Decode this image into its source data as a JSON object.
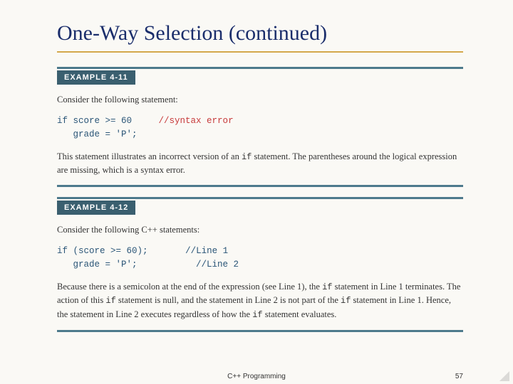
{
  "title": "One-Way Selection (continued)",
  "example1": {
    "label": "EXAMPLE 4-11",
    "intro": "Consider the following statement:",
    "code_line1_prefix": "if",
    "code_line1_cond": " score >= 60",
    "code_line1_comment": "//syntax error",
    "code_line2": "   grade = 'P';",
    "explain_before": "This statement illustrates an incorrect version of an ",
    "explain_code": "if",
    "explain_after": " statement. The parentheses around the logical expression are missing, which is a syntax error."
  },
  "example2": {
    "label": "EXAMPLE 4-12",
    "intro": "Consider the following C++ statements:",
    "code_line1_prefix": "if",
    "code_line1_cond": " (score >= 60);",
    "code_line1_comment": "//Line 1",
    "code_line2_body": "   grade = 'P';",
    "code_line2_comment": "//Line 2",
    "p1a": "Because there is a semicolon at the end of the expression (see Line 1), the ",
    "p1b": " statement in Line 1 terminates. The action of this ",
    "p1c": " statement is null, and the statement in Line 2 is not part of the ",
    "p1d": " statement in Line 1. Hence, the statement in Line 2 executes regardless of how the ",
    "p1e": " statement evaluates.",
    "code_if": "if"
  },
  "footer": {
    "center": "C++ Programming",
    "page": "57"
  }
}
